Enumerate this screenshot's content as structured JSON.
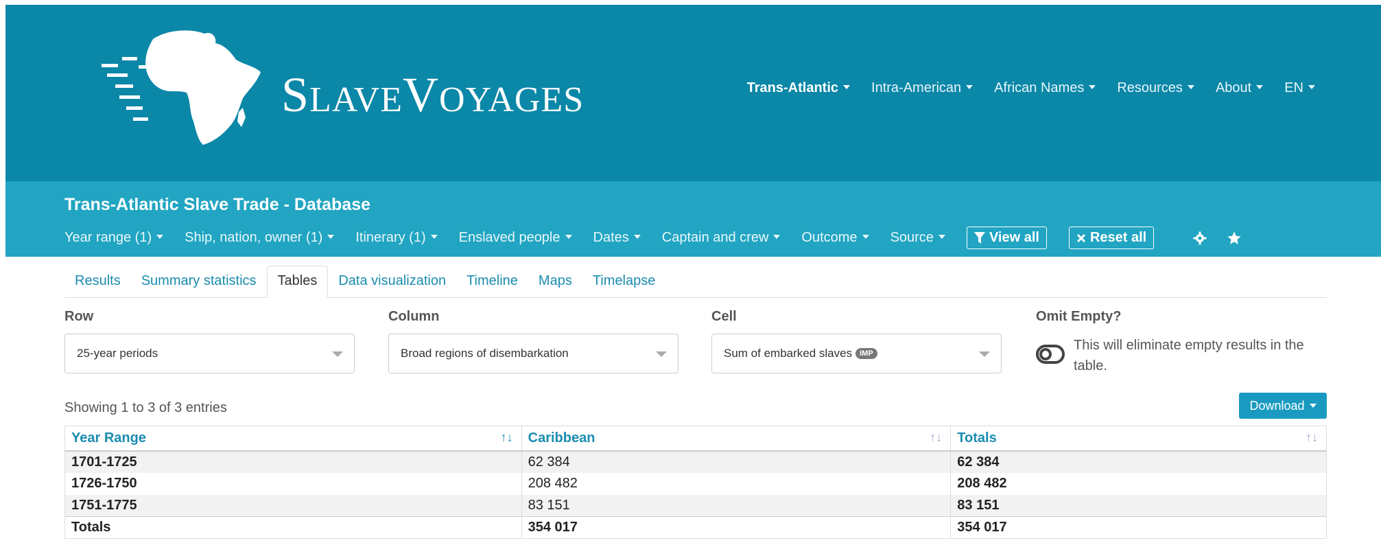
{
  "brand": {
    "first_cap": "S",
    "first_rest": "LAVE",
    "second_cap": "V",
    "second_rest": "OYAGES"
  },
  "main_nav": [
    {
      "label": "Trans-Atlantic"
    },
    {
      "label": "Intra-American"
    },
    {
      "label": "African Names"
    },
    {
      "label": "Resources"
    },
    {
      "label": "About"
    },
    {
      "label": "EN"
    }
  ],
  "database_title": "Trans-Atlantic Slave Trade - Database",
  "filters": [
    {
      "label": "Year range (1)"
    },
    {
      "label": "Ship, nation, owner (1)"
    },
    {
      "label": "Itinerary (1)"
    },
    {
      "label": "Enslaved people"
    },
    {
      "label": "Dates"
    },
    {
      "label": "Captain and crew"
    },
    {
      "label": "Outcome"
    },
    {
      "label": "Source"
    }
  ],
  "view_all_label": "View all",
  "reset_all_label": "Reset all",
  "tabs": [
    {
      "label": "Results"
    },
    {
      "label": "Summary statistics"
    },
    {
      "label": "Tables"
    },
    {
      "label": "Data visualization"
    },
    {
      "label": "Timeline"
    },
    {
      "label": "Maps"
    },
    {
      "label": "Timelapse"
    }
  ],
  "row": {
    "label": "Row",
    "value": "25-year periods"
  },
  "column": {
    "label": "Column",
    "value": "Broad regions of disembarkation"
  },
  "cell": {
    "label": "Cell",
    "value": "Sum of embarked slaves",
    "badge": "IMP"
  },
  "omit_empty": {
    "label": "Omit Empty?",
    "description": "This will eliminate empty results in the table."
  },
  "showing_text": "Showing 1 to 3 of 3 entries",
  "download_label": "Download",
  "table": {
    "headers": [
      "Year Range",
      "Caribbean",
      "Totals"
    ],
    "rows": [
      [
        "1701-1725",
        "62 384",
        "62 384"
      ],
      [
        "1726-1750",
        "208 482",
        "208 482"
      ],
      [
        "1751-1775",
        "83 151",
        "83 151"
      ]
    ],
    "totals": [
      "Totals",
      "354 017",
      "354 017"
    ]
  },
  "colors": {
    "header_bg": "#0b87a8",
    "subheader_bg": "#21a5c2",
    "link": "#1a8cb0",
    "download_bg": "#1a9ac0"
  }
}
